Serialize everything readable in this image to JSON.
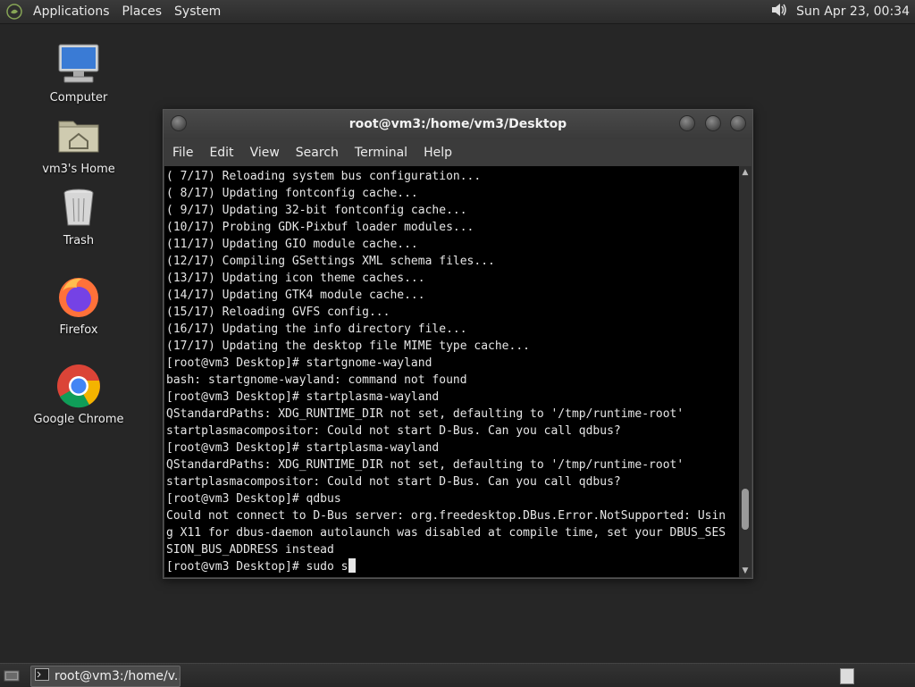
{
  "top_panel": {
    "menus": [
      "Applications",
      "Places",
      "System"
    ],
    "clock": "Sun Apr 23, 00:34",
    "icons": {
      "logo": "mate-logo-icon",
      "volume": "volume-icon"
    }
  },
  "desktop": {
    "icons": [
      {
        "label": "Computer",
        "icon": "computer-icon"
      },
      {
        "label": "vm3's Home",
        "icon": "home-folder-icon"
      },
      {
        "label": "Trash",
        "icon": "trash-icon"
      },
      {
        "label": "Firefox",
        "icon": "firefox-icon"
      },
      {
        "label": "Google Chrome",
        "icon": "chrome-icon"
      }
    ]
  },
  "terminal": {
    "title": "root@vm3:/home/vm3/Desktop",
    "menus": [
      "File",
      "Edit",
      "View",
      "Search",
      "Terminal",
      "Help"
    ],
    "lines": [
      "( 7/17) Reloading system bus configuration...",
      "( 8/17) Updating fontconfig cache...",
      "( 9/17) Updating 32-bit fontconfig cache...",
      "(10/17) Probing GDK-Pixbuf loader modules...",
      "(11/17) Updating GIO module cache...",
      "(12/17) Compiling GSettings XML schema files...",
      "(13/17) Updating icon theme caches...",
      "(14/17) Updating GTK4 module cache...",
      "(15/17) Reloading GVFS config...",
      "(16/17) Updating the info directory file...",
      "(17/17) Updating the desktop file MIME type cache...",
      "[root@vm3 Desktop]# startgnome-wayland",
      "bash: startgnome-wayland: command not found",
      "[root@vm3 Desktop]# startplasma-wayland",
      "QStandardPaths: XDG_RUNTIME_DIR not set, defaulting to '/tmp/runtime-root'",
      "startplasmacompositor: Could not start D-Bus. Can you call qdbus?",
      "[root@vm3 Desktop]# startplasma-wayland",
      "QStandardPaths: XDG_RUNTIME_DIR not set, defaulting to '/tmp/runtime-root'",
      "startplasmacompositor: Could not start D-Bus. Can you call qdbus?",
      "[root@vm3 Desktop]# qdbus",
      "Could not connect to D-Bus server: org.freedesktop.DBus.Error.NotSupported: Usin",
      "g X11 for dbus-daemon autolaunch was disabled at compile time, set your DBUS_SES",
      "SION_BUS_ADDRESS instead"
    ],
    "prompt_line": "[root@vm3 Desktop]# sudo s",
    "scroll_position": 0.9
  },
  "bottom_panel": {
    "task_label": "root@vm3:/home/v...",
    "icons": {
      "show_desktop": "show-desktop-icon",
      "task": "terminal-icon",
      "workspace": "workspace-switcher-icon"
    }
  }
}
